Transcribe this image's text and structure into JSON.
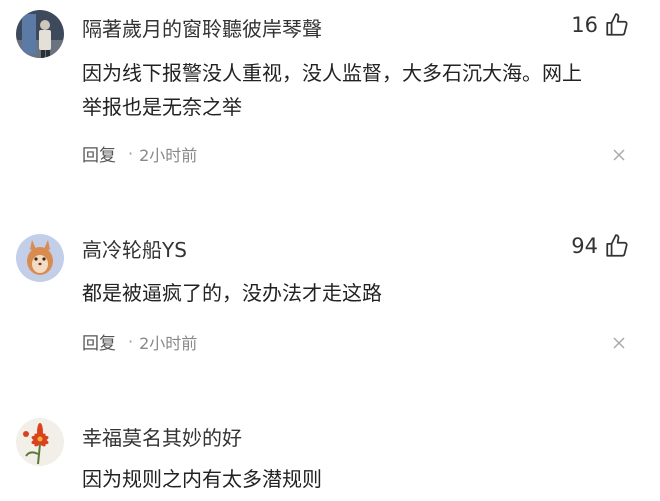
{
  "comments": [
    {
      "username": "隔著歲月的窗聆聽彼岸琴聲",
      "likes": "16",
      "text_line1": "因为线下报警没人重视，没人监督，大多石沉大海。网上",
      "text_line2": "举报也是无奈之举",
      "reply_label": "回复",
      "separator": "·",
      "time": "2小时前",
      "avatar_icon": "person-photo-icon"
    },
    {
      "username": "高冷轮船YS",
      "likes": "94",
      "text_line1": "都是被逼疯了的，没办法才走这路",
      "reply_label": "回复",
      "separator": "·",
      "time": "2小时前",
      "avatar_icon": "cartoon-avatar-icon"
    },
    {
      "username": "幸福莫名其妙的好",
      "text_line1": "因为规则之内有太多潜规则",
      "avatar_icon": "flower-avatar-icon"
    }
  ],
  "icons": {
    "like": "thumbs-up-icon",
    "dismiss": "close-icon"
  },
  "colors": {
    "text": "#222222",
    "meta": "#888888",
    "background": "#ffffff"
  }
}
